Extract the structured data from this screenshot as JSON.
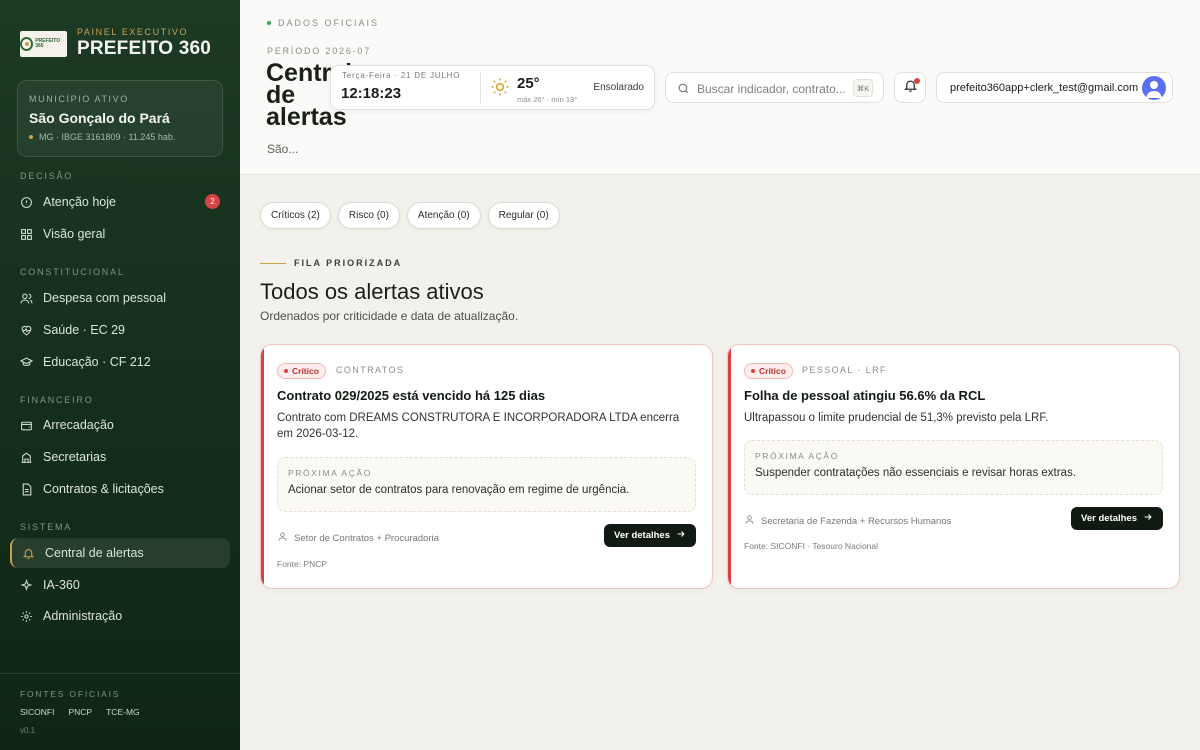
{
  "sidebar": {
    "brand_sub": "PAINEL EXECUTIVO",
    "brand_title": "PREFEITO 360",
    "logo_text": "PREFEITO 360",
    "municipality": {
      "label": "MUNICÍPIO ATIVO",
      "name": "São Gonçalo do Pará",
      "info": "MG · IBGE 3161809 · 11.245 hab."
    },
    "sections": {
      "decisao": "DECISÃO",
      "constitucional": "CONSTITUCIONAL",
      "financeiro": "FINANCEIRO",
      "sistema": "SISTEMA"
    },
    "items": [
      {
        "label": "Atenção hoje",
        "icon": "alert-circle-icon",
        "badge": "2"
      },
      {
        "label": "Visão geral",
        "icon": "grid-icon"
      },
      {
        "label": "Despesa com pessoal",
        "icon": "users-icon"
      },
      {
        "label": "Saúde · EC 29",
        "icon": "heart-pulse-icon"
      },
      {
        "label": "Educação · CF 212",
        "icon": "graduation-cap-icon"
      },
      {
        "label": "Arrecadação",
        "icon": "wallet-icon"
      },
      {
        "label": "Secretarias",
        "icon": "building-icon"
      },
      {
        "label": "Contratos & licitações",
        "icon": "file-text-icon"
      },
      {
        "label": "Central de alertas",
        "icon": "bell-icon",
        "active": true
      },
      {
        "label": "IA-360",
        "icon": "sparkles-icon"
      },
      {
        "label": "Administração",
        "icon": "settings-icon"
      }
    ],
    "footer": {
      "title": "FONTES OFICIAIS",
      "sources": [
        "SICONFI",
        "PNCP",
        "TCE-MG"
      ],
      "version": "v0.1"
    }
  },
  "header": {
    "eyebrow": "DADOS OFICIAIS",
    "period": "PERÍODO 2026-07",
    "title": "Central de alertas",
    "subtitle": "São...",
    "weather": {
      "date": "Terça-Feira · 21 DE JULHO",
      "time": "12:18:23",
      "temp": "25°",
      "range": "máx 26° · mín 13°",
      "condition": "Ensolarado"
    },
    "search": {
      "placeholder": "Buscar indicador, contrato...",
      "shortcut": "⌘K"
    },
    "user_email": "prefeito360app+clerk_test@gmail.com"
  },
  "filters": [
    "Críticos (2)",
    "Risco (0)",
    "Atenção (0)",
    "Regular (0)"
  ],
  "main": {
    "eyebrow": "FILA PRIORIZADA",
    "title": "Todos os alertas ativos",
    "subtitle": "Ordenados por criticidade e data de atualização."
  },
  "alerts": [
    {
      "severity": "Crítico",
      "category": "CONTRATOS",
      "title": "Contrato 029/2025 está vencido há 125 dias",
      "description": "Contrato com DREAMS CONSTRUTORA E INCORPORADORA LTDA encerra em 2026-03-12.",
      "next_label": "PRÓXIMA AÇÃO",
      "next_action": "Acionar setor de contratos para renovação em regime de urgência.",
      "owner": "Setor de Contratos + Procuradoria",
      "button": "Ver detalhes",
      "source": "Fonte: PNCP"
    },
    {
      "severity": "Crítico",
      "category": "PESSOAL · LRF",
      "title": "Folha de pessoal atingiu 56.6% da RCL",
      "description": "Ultrapassou o limite prudencial de 51,3% previsto pela LRF.",
      "next_label": "PRÓXIMA AÇÃO",
      "next_action": "Suspender contratações não essenciais e revisar horas extras.",
      "owner": "Secretaria de Fazenda + Recursos Humanos",
      "button": "Ver detalhes",
      "source": "Fonte: SICONFI · Tesouro Nacional"
    }
  ],
  "colors": {
    "sidebar": "#1d3a24",
    "accent_gold": "#c9a24a",
    "critical": "#d94040",
    "button": "#111a12"
  }
}
